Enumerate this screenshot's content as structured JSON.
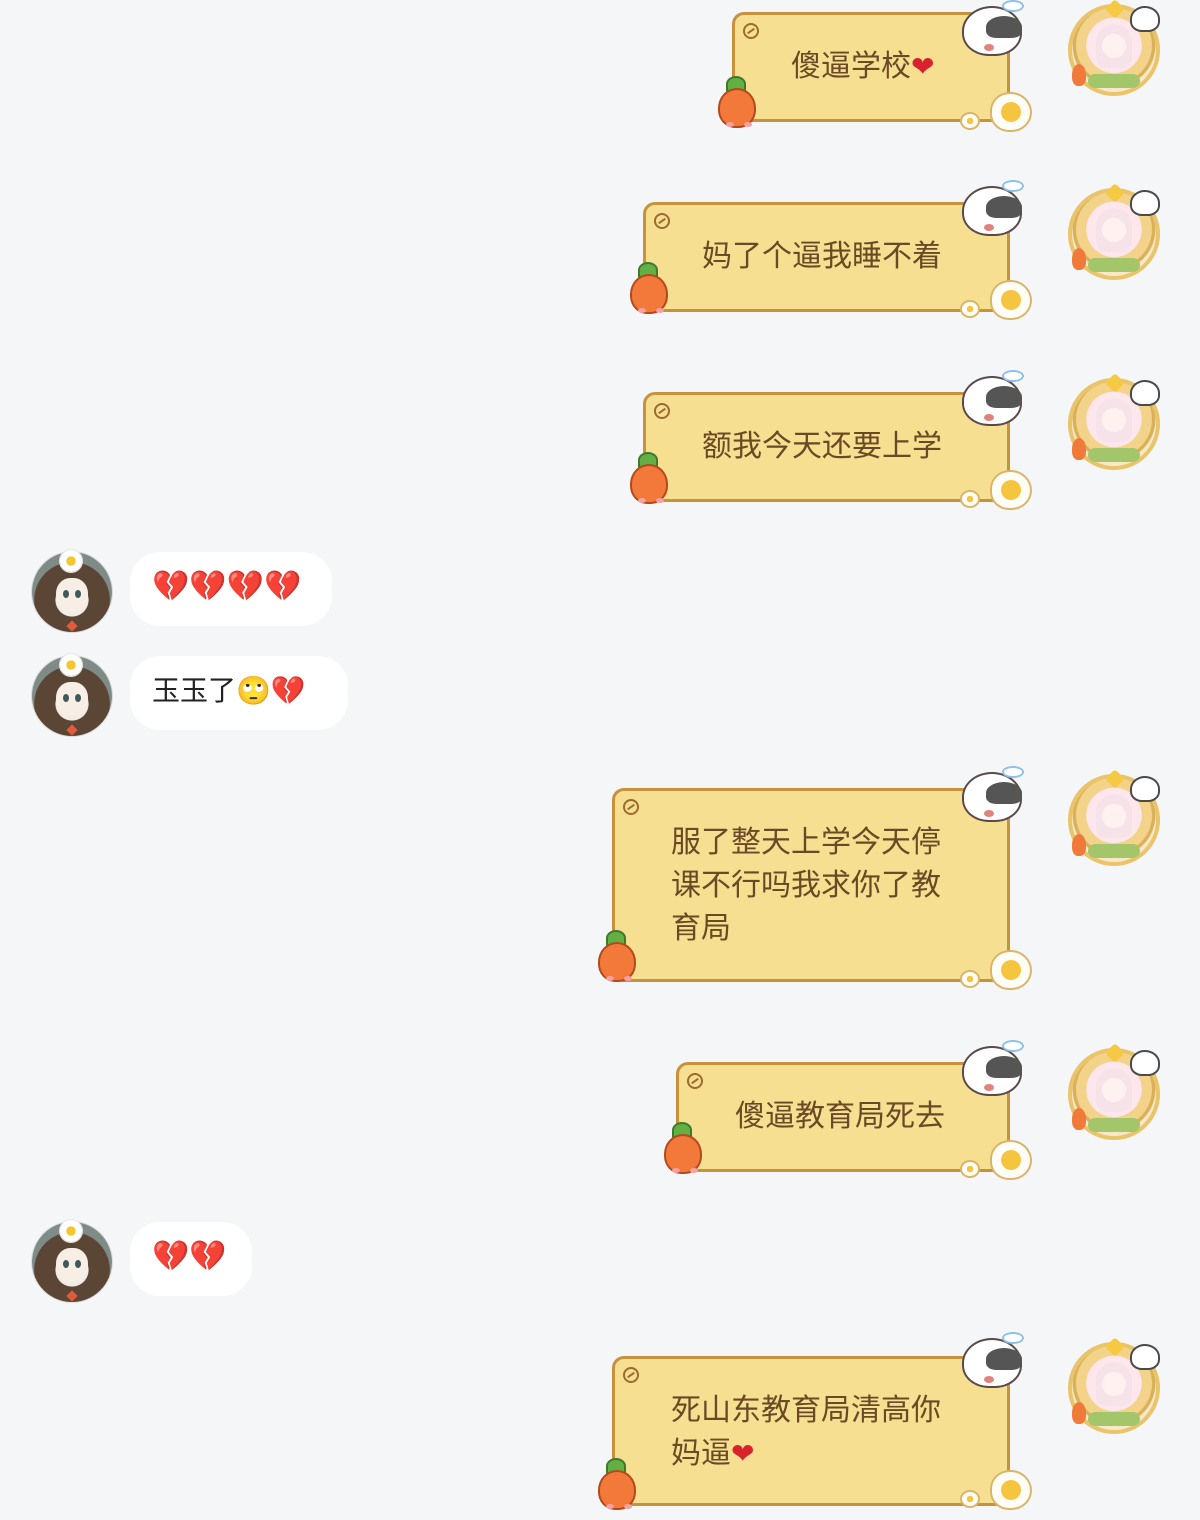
{
  "conversation": {
    "messages": [
      {
        "sender": "me",
        "text": "傻逼学校",
        "emoji": "❤"
      },
      {
        "sender": "me",
        "text": "妈了个逼我睡不着",
        "emoji": ""
      },
      {
        "sender": "me",
        "text": "额我今天还要上学",
        "emoji": ""
      },
      {
        "sender": "other",
        "text": "",
        "emoji": "💔💔💔💔"
      },
      {
        "sender": "other",
        "text": "玉玉了",
        "emoji": "🙄💔"
      },
      {
        "sender": "me",
        "lines": [
          "服了整天上学今天停",
          "课不行吗我求你了教",
          "育局"
        ],
        "emoji": ""
      },
      {
        "sender": "me",
        "text": "傻逼教育局死去",
        "emoji": ""
      },
      {
        "sender": "other",
        "text": "",
        "emoji": "💔💔"
      },
      {
        "sender": "me",
        "lines": [
          "死山东教育局清高你",
          "妈逼"
        ],
        "emoji": "❤"
      }
    ]
  },
  "avatars": {
    "me": "anime-girl-avatar",
    "other": "anime-girl-flower-avatar"
  },
  "colors": {
    "page_background": "#f5f6f8",
    "my_bubble_fill": "#f7df92",
    "my_bubble_border": "#c8923d",
    "my_text": "#6a4a24",
    "other_bubble_fill": "#ffffff"
  }
}
